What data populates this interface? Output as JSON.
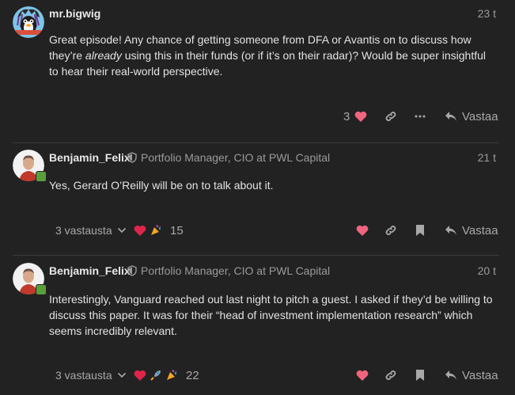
{
  "posts": [
    {
      "username": "mr.bigwig",
      "date": "23 t",
      "body_pre": "Great episode! Any chance of getting someone from DFA or Avantis on to discuss how they’re ",
      "body_em": "already",
      "body_post": " using this in their funds (or if it’s on their radar)? Would be super insightful to hear their real-world perspective.",
      "like_count": "3",
      "reply_label": "Vastaa"
    },
    {
      "username": "Benjamin_Felix",
      "user_title": "Portfolio Manager, CIO at PWL Capital",
      "date": "21 t",
      "body": "Yes, Gerard O’Reilly will be on to talk about it.",
      "replies_label": "3 vastausta",
      "reaction_count": "15",
      "reply_label": "Vastaa"
    },
    {
      "username": "Benjamin_Felix",
      "user_title": "Portfolio Manager, CIO at PWL Capital",
      "date": "20 t",
      "body": "Interestingly, Vanguard reached out last night to pitch a guest. I asked if they’d be willing to discuss this paper. It was for their “head of investment implementation research” which seems incredibly relevant.",
      "replies_label": "3 vastausta",
      "reaction_count": "22",
      "reply_label": "Vastaa"
    }
  ],
  "colors": {
    "background": "#222222",
    "heart": "#f1647d",
    "muted": "#a8a8a8",
    "divider": "#3a3a3a"
  }
}
